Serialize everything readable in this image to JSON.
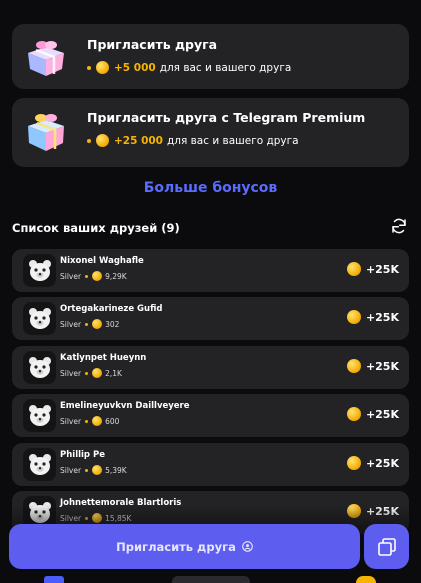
{
  "invites": [
    {
      "title": "Пригласить друга",
      "amount": "+5 000",
      "suffix": "для вас и вашего друга",
      "icon": "gift-icon"
    },
    {
      "title": "Пригласить друга с Telegram Premium",
      "amount": "+25 000",
      "suffix": "для вас и вашего друга",
      "icon": "premium-gift-icon"
    }
  ],
  "more_bonuses": "Больше бонусов",
  "friends_header": "Список ваших друзей (9)",
  "friends": [
    {
      "name": "Nixonel Waghafle",
      "league": "Silver",
      "coins": "9,29K",
      "bonus": "+25K"
    },
    {
      "name": "Ortegakarineze Gufid",
      "league": "Silver",
      "coins": "302",
      "bonus": "+25K"
    },
    {
      "name": "Katlynpet Hueynn",
      "league": "Silver",
      "coins": "2,1K",
      "bonus": "+25K"
    },
    {
      "name": "Emelineyuvkvn Daillveyere",
      "league": "Silver",
      "coins": "600",
      "bonus": "+25K"
    },
    {
      "name": "Phillip Pe",
      "league": "Silver",
      "coins": "5,39K",
      "bonus": "+25K"
    },
    {
      "name": "Johnettemorale Blartloris",
      "league": "Silver",
      "coins": "15,85K",
      "bonus": "+25K"
    }
  ],
  "invite_button": "Пригласить друга",
  "colors": {
    "background": "#0b0b0d",
    "card": "#232326",
    "accent": "#5d5ef0",
    "link": "#5a6cff",
    "coin": "#f5b400"
  }
}
